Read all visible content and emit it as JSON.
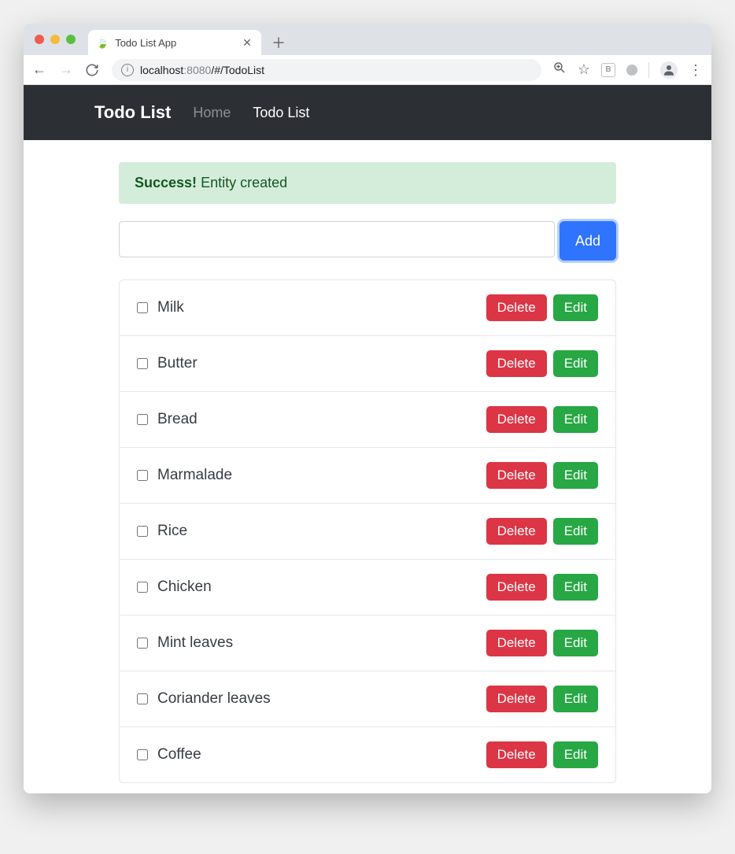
{
  "browser": {
    "tab_title": "Todo List App",
    "url": {
      "host": "localhost",
      "port": ":8080",
      "path": "/#/TodoList"
    }
  },
  "app": {
    "brand": "Todo List",
    "nav": [
      {
        "label": "Home",
        "active": false
      },
      {
        "label": "Todo List",
        "active": true
      }
    ]
  },
  "alert": {
    "strong": "Success!",
    "message": "Entity created"
  },
  "add_form": {
    "input_value": "",
    "button_label": "Add"
  },
  "item_actions": {
    "delete_label": "Delete",
    "edit_label": "Edit"
  },
  "todos": [
    {
      "label": "Milk",
      "checked": false
    },
    {
      "label": "Butter",
      "checked": false
    },
    {
      "label": "Bread",
      "checked": false
    },
    {
      "label": "Marmalade",
      "checked": false
    },
    {
      "label": "Rice",
      "checked": false
    },
    {
      "label": "Chicken",
      "checked": false
    },
    {
      "label": "Mint leaves",
      "checked": false
    },
    {
      "label": "Coriander leaves",
      "checked": false
    },
    {
      "label": "Coffee",
      "checked": false
    }
  ]
}
